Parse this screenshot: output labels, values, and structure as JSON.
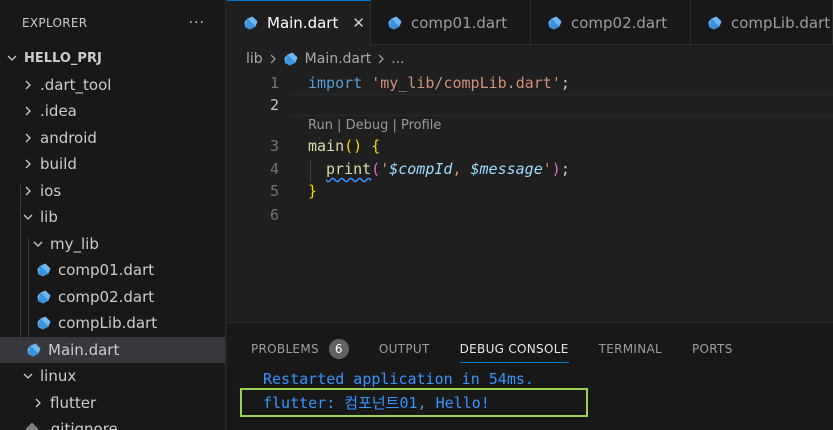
{
  "explorer": {
    "title": "EXPLORER",
    "more": "···",
    "tree": [
      {
        "label": "HELLO_PRJ",
        "kind": "root",
        "depth": 0,
        "chevron": "down"
      },
      {
        "label": ".dart_tool",
        "kind": "folder",
        "depth": 1,
        "chevron": "right"
      },
      {
        "label": ".idea",
        "kind": "folder",
        "depth": 1,
        "chevron": "right"
      },
      {
        "label": "android",
        "kind": "folder",
        "depth": 1,
        "chevron": "right"
      },
      {
        "label": "build",
        "kind": "folder",
        "depth": 1,
        "chevron": "right"
      },
      {
        "label": "ios",
        "kind": "folder",
        "depth": 1,
        "chevron": "right"
      },
      {
        "label": "lib",
        "kind": "folder",
        "depth": 1,
        "chevron": "down"
      },
      {
        "label": "my_lib",
        "kind": "folder",
        "depth": 2,
        "chevron": "down"
      },
      {
        "label": "comp01.dart",
        "kind": "dart",
        "depth": 3
      },
      {
        "label": "comp02.dart",
        "kind": "dart",
        "depth": 3
      },
      {
        "label": "compLib.dart",
        "kind": "dart",
        "depth": 3
      },
      {
        "label": "Main.dart",
        "kind": "dart",
        "depth": 2,
        "selected": true
      },
      {
        "label": "linux",
        "kind": "folder",
        "depth": 1,
        "chevron": "down"
      },
      {
        "label": "flutter",
        "kind": "folder",
        "depth": 2,
        "chevron": "right"
      },
      {
        "label": ".gitignore",
        "kind": "file",
        "depth": 1
      }
    ]
  },
  "tabs": [
    {
      "label": "Main.dart",
      "active": true,
      "close": "✕"
    },
    {
      "label": "comp01.dart"
    },
    {
      "label": "comp02.dart"
    },
    {
      "label": "compLib.dart"
    }
  ],
  "breadcrumb": {
    "folder": "lib",
    "file": "Main.dart",
    "ellipsis": "..."
  },
  "editor": {
    "line_numbers": [
      "1",
      "2",
      "3",
      "4",
      "5",
      "6"
    ],
    "line1": {
      "kw": "import",
      "str": "'my_lib/compLib.dart'",
      "end": ";"
    },
    "codelens": "Run | Debug | Profile",
    "line3": {
      "fn": "main",
      "paren": "()",
      "brace": "{"
    },
    "line4": {
      "fn": "print",
      "open": "(",
      "q1": "'",
      "v1": "$compId",
      "mid": ", ",
      "v2": "$message",
      "q2": "'",
      "close": ")",
      "end": ";"
    },
    "line5": {
      "brace": "}"
    }
  },
  "panel": {
    "tabs": [
      {
        "label": "PROBLEMS",
        "badge": "6"
      },
      {
        "label": "OUTPUT"
      },
      {
        "label": "DEBUG CONSOLE",
        "active": true
      },
      {
        "label": "TERMINAL"
      },
      {
        "label": "PORTS"
      }
    ],
    "console": [
      "Restarted application in 54ms.",
      "flutter: 컴포넌트01, Hello!"
    ],
    "highlight_color": "#9bd35a"
  }
}
